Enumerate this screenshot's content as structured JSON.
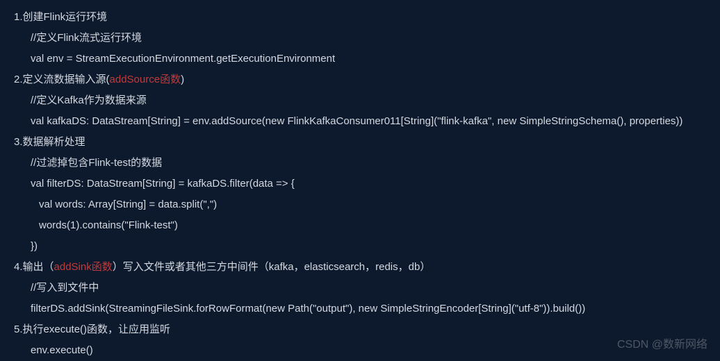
{
  "lines": {
    "l1": "1.创建Flink运行环境",
    "l2": "//定义Flink流式运行环境",
    "l3": "val env = StreamExecutionEnvironment.getExecutionEnvironment",
    "l4a": "2.定义流数据输入源(",
    "l4b": "addSource函数",
    "l4c": ")",
    "l5": "//定义Kafka作为数据来源",
    "l6": "val kafkaDS: DataStream[String] = env.addSource(new FlinkKafkaConsumer011[String](\"flink-kafka\", new SimpleStringSchema(), properties))",
    "l7": "3.数据解析处理",
    "l8": "//过滤掉包含Flink-test的数据",
    "l9": "val filterDS: DataStream[String] = kafkaDS.filter(data => {",
    "l10": "val words: Array[String] = data.split(\",\")",
    "l11": "words(1).contains(\"Flink-test\")",
    "l12": "})",
    "l13a": "4.输出（",
    "l13b": "addSink函数",
    "l13c": "）写入文件或者其他三方中间件（kafka，elasticsearch，redis，db）",
    "l14": "//写入到文件中",
    "l15": "filterDS.addSink(StreamingFileSink.forRowFormat(new Path(\"output\"), new SimpleStringEncoder[String](\"utf-8\")).build())",
    "l16": "5.执行execute()函数，让应用监听",
    "l17": "env.execute()"
  },
  "watermark": "CSDN @数新网络"
}
